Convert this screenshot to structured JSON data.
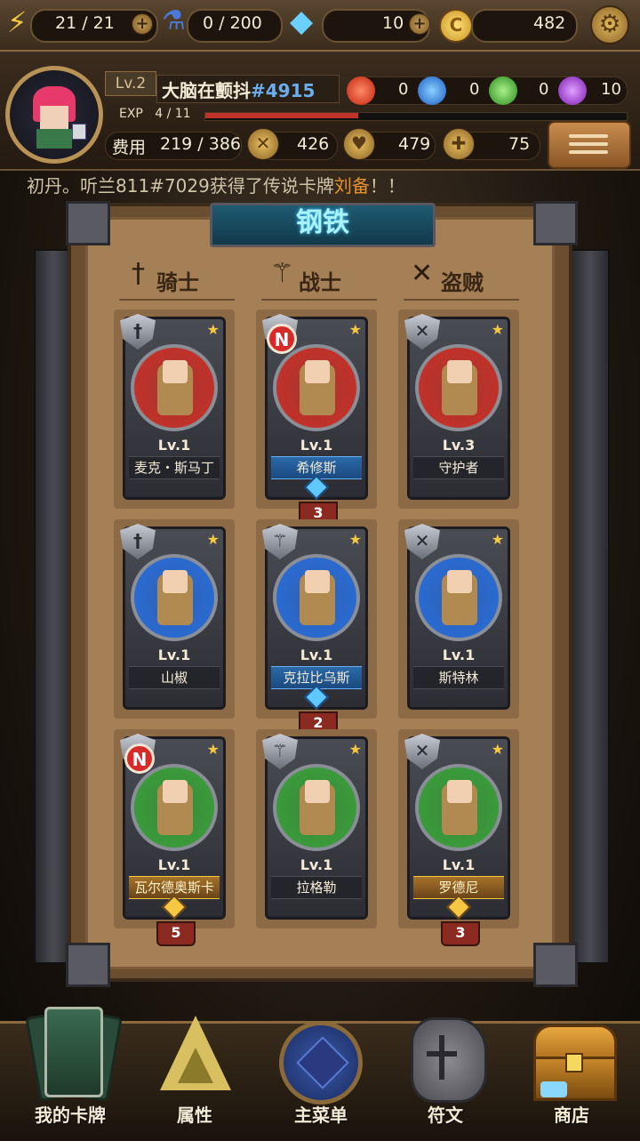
{
  "resources": {
    "energy": "21 / 21",
    "potion": "0 / 200",
    "diamonds": "10",
    "gold": "482"
  },
  "profile": {
    "level": "Lv.2",
    "name": "大脑在颤抖",
    "tag": "#4915",
    "exp_label": "EXP   4 / 11",
    "exp_progress": 0.364,
    "gems": {
      "red": "0",
      "blue": "0",
      "green": "0",
      "purple": "10"
    },
    "cost_label": "费用",
    "cost_value": "219 / 386",
    "attack": "426",
    "defense": "479",
    "health": "75"
  },
  "ticker": {
    "prefix": "初丹。听兰811#7029获得了传说卡牌",
    "highlight": "刘备",
    "suffix": "！！"
  },
  "panel": {
    "title": "钢铁",
    "classes": [
      "骑士",
      "战士",
      "盗贼"
    ]
  },
  "cards": [
    {
      "level": "Lv.1",
      "name": "麦克・斯马丁",
      "rarity": "common",
      "color": "#c0322a"
    },
    {
      "level": "Lv.1",
      "name": "希修斯",
      "rarity": "epic",
      "color": "#c0322a",
      "new": "N",
      "count": "3"
    },
    {
      "level": "Lv.3",
      "name": "守护者",
      "rarity": "common",
      "color": "#c0322a"
    },
    {
      "level": "Lv.1",
      "name": "山椒",
      "rarity": "common",
      "color": "#2a6ad0"
    },
    {
      "level": "Lv.1",
      "name": "克拉比乌斯",
      "rarity": "epic",
      "color": "#2a6ad0",
      "count": "2"
    },
    {
      "level": "Lv.1",
      "name": "斯特林",
      "rarity": "common",
      "color": "#2a6ad0"
    },
    {
      "level": "Lv.1",
      "name": "瓦尔德奥斯卡",
      "rarity": "legend",
      "color": "#3a9a3a",
      "new": "N",
      "count": "5"
    },
    {
      "level": "Lv.1",
      "name": "拉格勒",
      "rarity": "common",
      "color": "#3a9a3a"
    },
    {
      "level": "Lv.1",
      "name": "罗德尼",
      "rarity": "legend",
      "color": "#3a9a3a",
      "count": "3"
    }
  ],
  "nav": [
    "我的卡牌",
    "属性",
    "主菜单",
    "符文",
    "商店"
  ]
}
